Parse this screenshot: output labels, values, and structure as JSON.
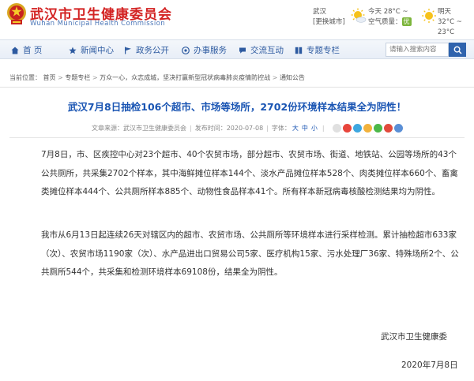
{
  "header": {
    "site_title": "武汉市卫生健康委员会",
    "site_subtitle": "Wuhan Municipal Health Commission",
    "city": "武汉",
    "switch_city": "[更换城市]",
    "today_label": "今天",
    "today_temp": "28°C ~",
    "air_label": "空气质量：",
    "air_value": "优",
    "tomorrow_label": "明天",
    "tomorrow_temp": "32°C ~ 23°C"
  },
  "nav": {
    "items": [
      {
        "label": "首 页"
      },
      {
        "label": "新闻中心"
      },
      {
        "label": "政务公开"
      },
      {
        "label": "办事服务"
      },
      {
        "label": "交流互动"
      },
      {
        "label": "专题专栏"
      }
    ],
    "search_placeholder": "请输入搜索内容"
  },
  "breadcrumb": {
    "prefix": "当前位置：",
    "items": [
      "首页",
      "专题专栏",
      "万众一心，众志成城，坚决打赢新型冠状病毒肺炎疫情防控战",
      "通知公告"
    ]
  },
  "article": {
    "title": "武汉7月8日抽检106个超市、市场等场所，2702份环境样本结果全为阴性！",
    "source_label": "文章来源：",
    "source": "武汉市卫生健康委员会",
    "date_label": "发布时间：",
    "date": "2020-07-08",
    "font_label": "字体：",
    "font_large": "大",
    "font_medium": "中",
    "font_small": "小",
    "paragraph1": "7月8日，市、区疾控中心对23个超市、40个农贸市场，部分超市、农贸市场、街道、地铁站、公园等场所的43个公共厕所，共采集2702个样本，其中海鲜摊位样本144个、淡水产品摊位样本528个、肉类摊位样本660个、畜禽类摊位样本444个、公共厕所样本885个、动物性食品样本41个。所有样本新冠病毒核酸检测结果均为阴性。",
    "paragraph2": "我市从6月13日起连续26天对辖区内的超市、农贸市场、公共厕所等环境样本进行采样检测。累计抽检超市633家（次）、农贸市场1190家（次）、水产品进出口贸易公司5家、医疗机构15家、污水处理厂36家、特殊场所2个、公共厕所544个，共采集和检测环境样本69108份，结果全为阴性。",
    "signature_org": "武汉市卫生健康委",
    "signature_date": "2020年7月8日"
  },
  "colors": {
    "brand_red": "#d32323",
    "link_blue": "#1a55b3",
    "nav_blue": "#2d5aa0",
    "air_good_green": "#7cb53b"
  }
}
